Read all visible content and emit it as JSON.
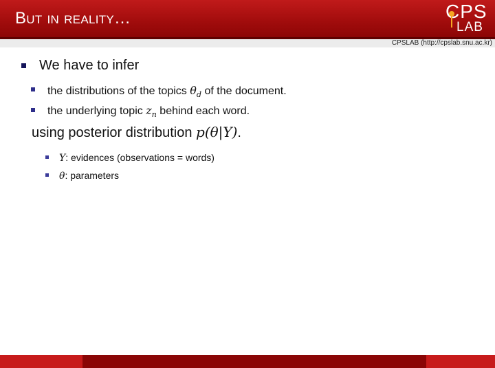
{
  "header": {
    "title": "But in reality…",
    "logo_top": "CPS",
    "logo_bottom": "LAB",
    "lab_url": "CPSLAB (http://cpslab.snu.ac.kr)"
  },
  "bullets": {
    "level1": "We have to infer",
    "sub1_pre": "the distributions of the topics ",
    "sub1_math": "θ",
    "sub1_sub": "d",
    "sub1_post": " of the document.",
    "sub2_pre": "the underlying topic ",
    "sub2_math": "z",
    "sub2_sub": "n",
    "sub2_post": " behind each word.",
    "plain_pre": "using posterior distribution ",
    "plain_math": "p(θ|Y)",
    "plain_post": ".",
    "sub3_math": "Y",
    "sub3_text": ": evidences (observations = words)",
    "sub4_math": "θ",
    "sub4_text": ": parameters"
  },
  "colors": {
    "header_red": "#a30d0d",
    "bullet_blue": "#14145a",
    "logo_accent": "#f5a623"
  }
}
